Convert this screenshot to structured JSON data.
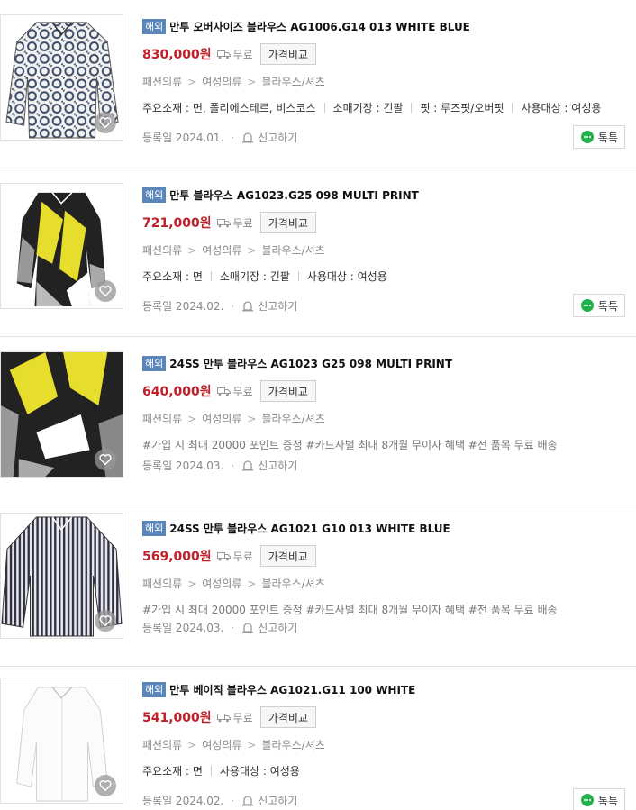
{
  "common": {
    "badge": "해외",
    "shipping_label": "무료",
    "compare_label": "가격비교",
    "report_label": "신고하기",
    "talk_label": "톡톡",
    "category_path": [
      "패션의류",
      "여성의류",
      "블라우스/셔츠"
    ],
    "category_sep": ">"
  },
  "products": [
    {
      "title": "만투 오버사이즈 블라우스 AG1006.G14 013 WHITE BLUE",
      "price": "830,000원",
      "attrs": [
        "주요소재 : 면, 폴리에스테르, 비스코스",
        "소매기장 : 긴팔",
        "핏 : 루즈핏/오버핏",
        "사용대상 : 여성용"
      ],
      "tags": "",
      "registered": "등록일 2024.01.",
      "image": "pattern-white-blue"
    },
    {
      "title": "만투 블라우스 AG1023.G25 098 MULTI PRINT",
      "price": "721,000원",
      "attrs": [
        "주요소재 : 면",
        "소매기장 : 긴팔",
        "사용대상 : 여성용"
      ],
      "tags": "",
      "registered": "등록일 2024.02.",
      "image": "multi-print"
    },
    {
      "title": "24SS 만투 블라우스 AG1023 G25 098 MULTI PRINT",
      "price": "640,000원",
      "attrs": [],
      "tags": "#가입 시 최대 20000 포인트 증정 #카드사별 최대 8개월 무이자 혜택 #전 품목 무료 배송",
      "registered": "등록일 2024.03.",
      "image": "multi-print"
    },
    {
      "title": "24SS 만투 블라우스 AG1021 G10 013 WHITE BLUE",
      "price": "569,000원",
      "attrs": [],
      "tags": "#가입 시 최대 20000 포인트 증정 #카드사별 최대 8개월 무이자 혜택 #전 품목 무료 배송",
      "registered": "등록일 2024.03.",
      "image": "stripes"
    },
    {
      "title": "만투 베이직 블라우스 AG1021.G11 100 WHITE",
      "price": "541,000원",
      "attrs": [
        "주요소재 : 면",
        "사용대상 : 여성용"
      ],
      "tags": "",
      "registered": "등록일 2024.02.",
      "image": "plain-white"
    }
  ]
}
